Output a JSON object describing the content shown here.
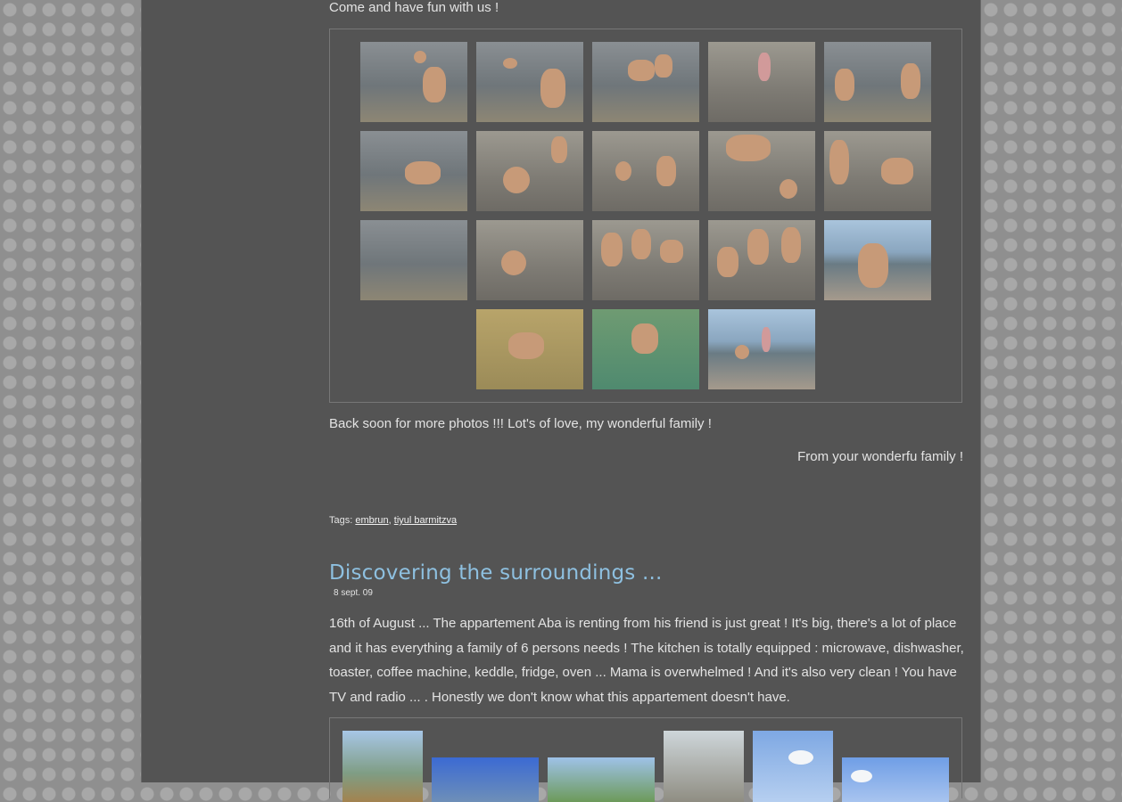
{
  "post1": {
    "intro": "Come and have fun with us !",
    "closing": "Back soon for more photos !!! Lot's of love, my wonderful family !",
    "signature": "From your wonderfu family !",
    "tags_label": "Tags:",
    "tags": [
      "embrun",
      "tiyul barmitzva"
    ]
  },
  "post2": {
    "title": "Discovering the surroundings ...",
    "date": "8 sept. 09",
    "body": "16th of August ... The appartement Aba is renting from his friend is just great ! It's big, there's a lot of place and it has everything a family of 6 persons needs ! The kitchen is totally equipped : microwave, dishwasher, toaster, coffee machine, keddle, fridge, oven ... Mama is overwhelmed ! And it's also very clean ! You have TV and radio ... . Honestly we don't know what this appartement doesn't have."
  },
  "colors": {
    "page_bg": "#545454",
    "title": "#8ec0e0",
    "text": "#e3e3e3"
  }
}
